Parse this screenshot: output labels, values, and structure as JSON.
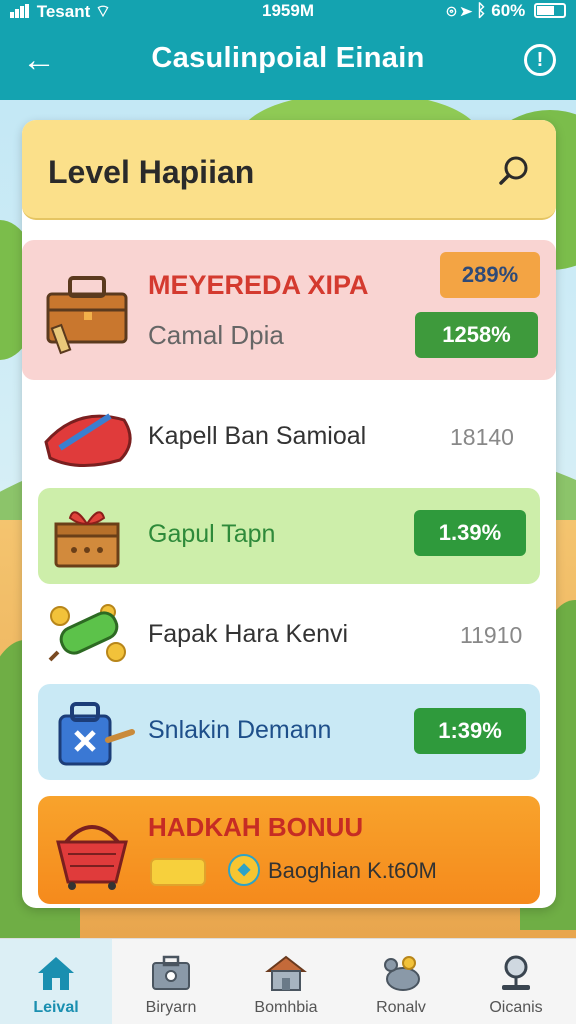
{
  "status_bar": {
    "carrier": "Tesant",
    "time": "1959M",
    "battery": "60%"
  },
  "header": {
    "title": "Casulinpoial Einain",
    "back_icon": "arrow-left-icon",
    "info_icon": "info-icon"
  },
  "level": {
    "title": "Level Hapiian",
    "search_icon": "search-icon"
  },
  "rows": [
    {
      "name": "MEYEREDA XIPA",
      "sub": "Camal Dpia",
      "pill_top": "289%",
      "pill_bottom": "1258%",
      "icon": "toolbox-icon"
    },
    {
      "name": "Kapell Ban Samioal",
      "value": "18140",
      "icon": "red-pillow-icon"
    },
    {
      "name": "Gapul Tapn",
      "pill": "1.39%",
      "icon": "gift-box-icon"
    },
    {
      "name": "Fapak Hara Kenvi",
      "value": "11910",
      "icon": "green-candle-icon"
    },
    {
      "name": "Snlakin Demann",
      "pill": "1:39%",
      "icon": "blue-bag-icon"
    },
    {
      "name": "HADKAH BONUU",
      "detail": "Baoghian K.t60M",
      "icon": "red-basket-icon"
    }
  ],
  "nav": [
    {
      "label": "Leival",
      "icon": "home-icon",
      "active": true
    },
    {
      "label": "Biryarn",
      "icon": "briefcase-icon",
      "active": false
    },
    {
      "label": "Bomhbia",
      "icon": "house-icon",
      "active": false
    },
    {
      "label": "Ronalv",
      "icon": "mouse-icon",
      "active": false
    },
    {
      "label": "Oicanis",
      "icon": "magnifier-stand-icon",
      "active": false
    }
  ],
  "colors": {
    "header": "#14a3b0",
    "level_header": "#fbe08a",
    "pill_green": "#2f9a3c",
    "pill_orange": "#f3a444",
    "bonus": "#f58a1c"
  }
}
